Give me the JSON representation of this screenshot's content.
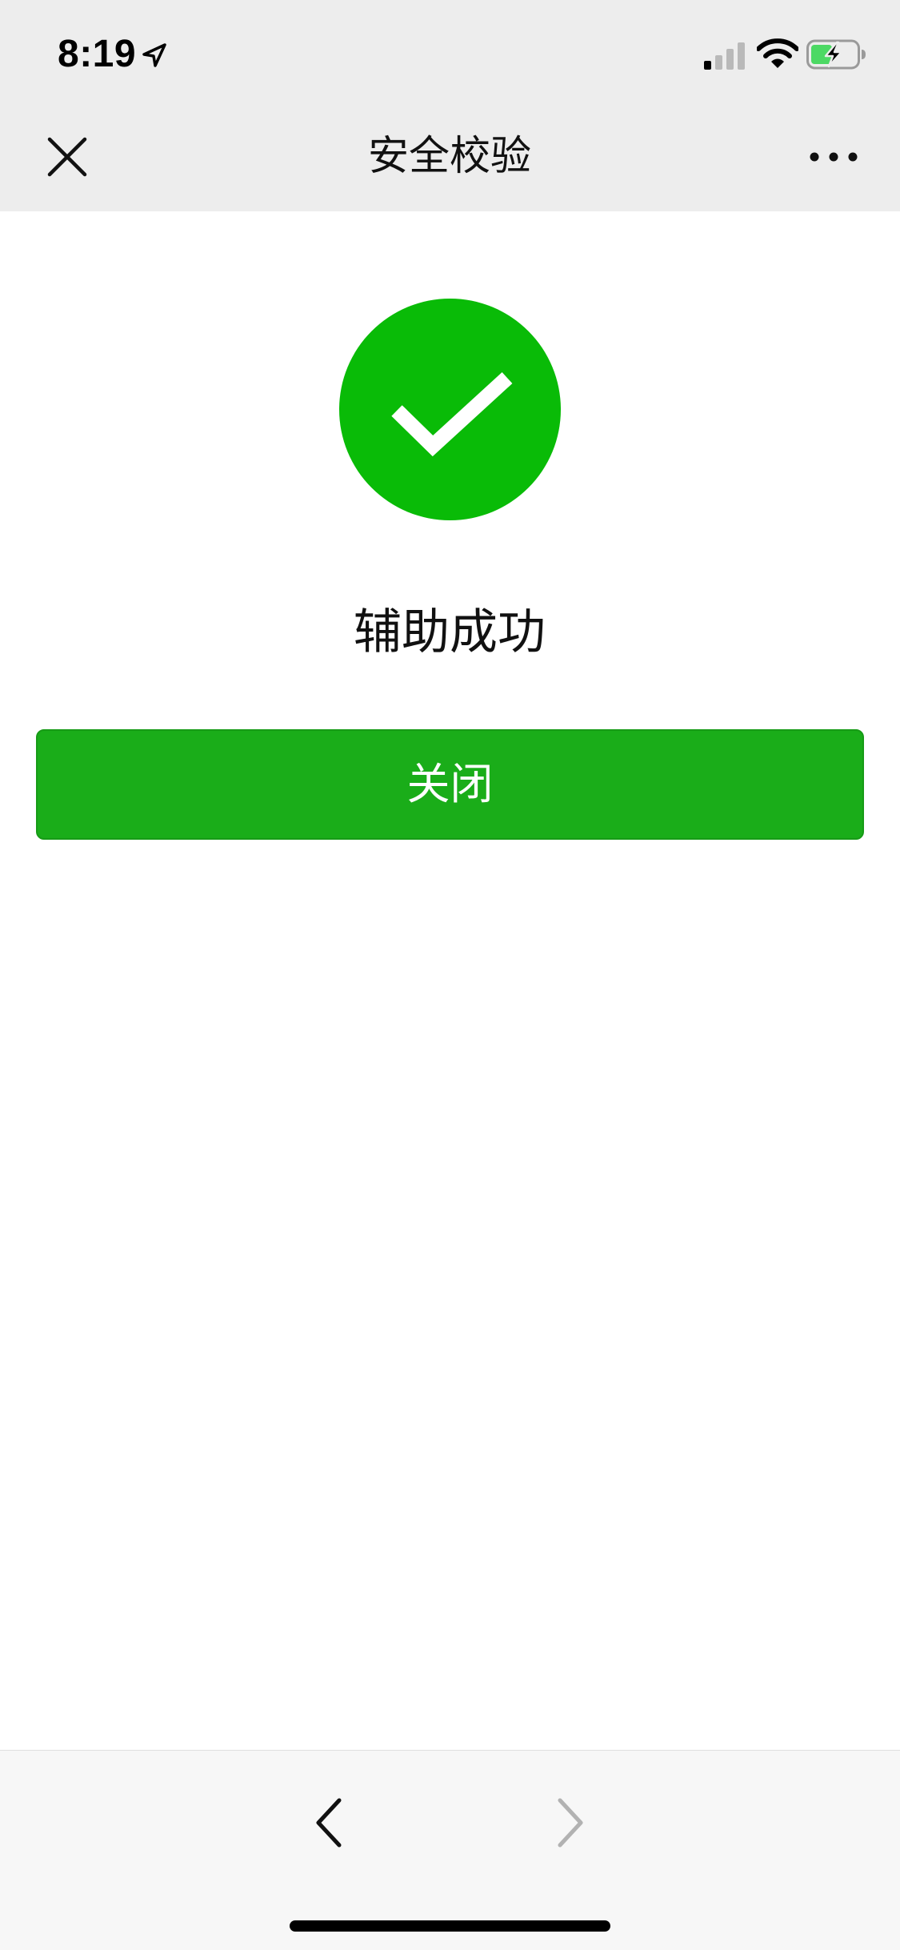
{
  "status_bar": {
    "time": "8:19",
    "icons": [
      "location-arrow-icon",
      "cellular-signal-icon",
      "wifi-icon",
      "battery-charging-icon"
    ]
  },
  "nav": {
    "title": "安全校验",
    "close_icon": "close-icon",
    "more_icon": "more-dots-icon"
  },
  "main": {
    "status_icon": "success-check-icon",
    "message": "辅助成功",
    "close_button_label": "关闭"
  },
  "toolbar": {
    "back_icon": "chevron-left-icon",
    "forward_icon": "chevron-right-icon",
    "forward_enabled": false
  },
  "colors": {
    "accent_green": "#09bb07",
    "button_green": "#1aad19",
    "header_bg": "#ededed",
    "toolbar_bg": "#f7f7f7",
    "battery_green": "#4cd964"
  }
}
